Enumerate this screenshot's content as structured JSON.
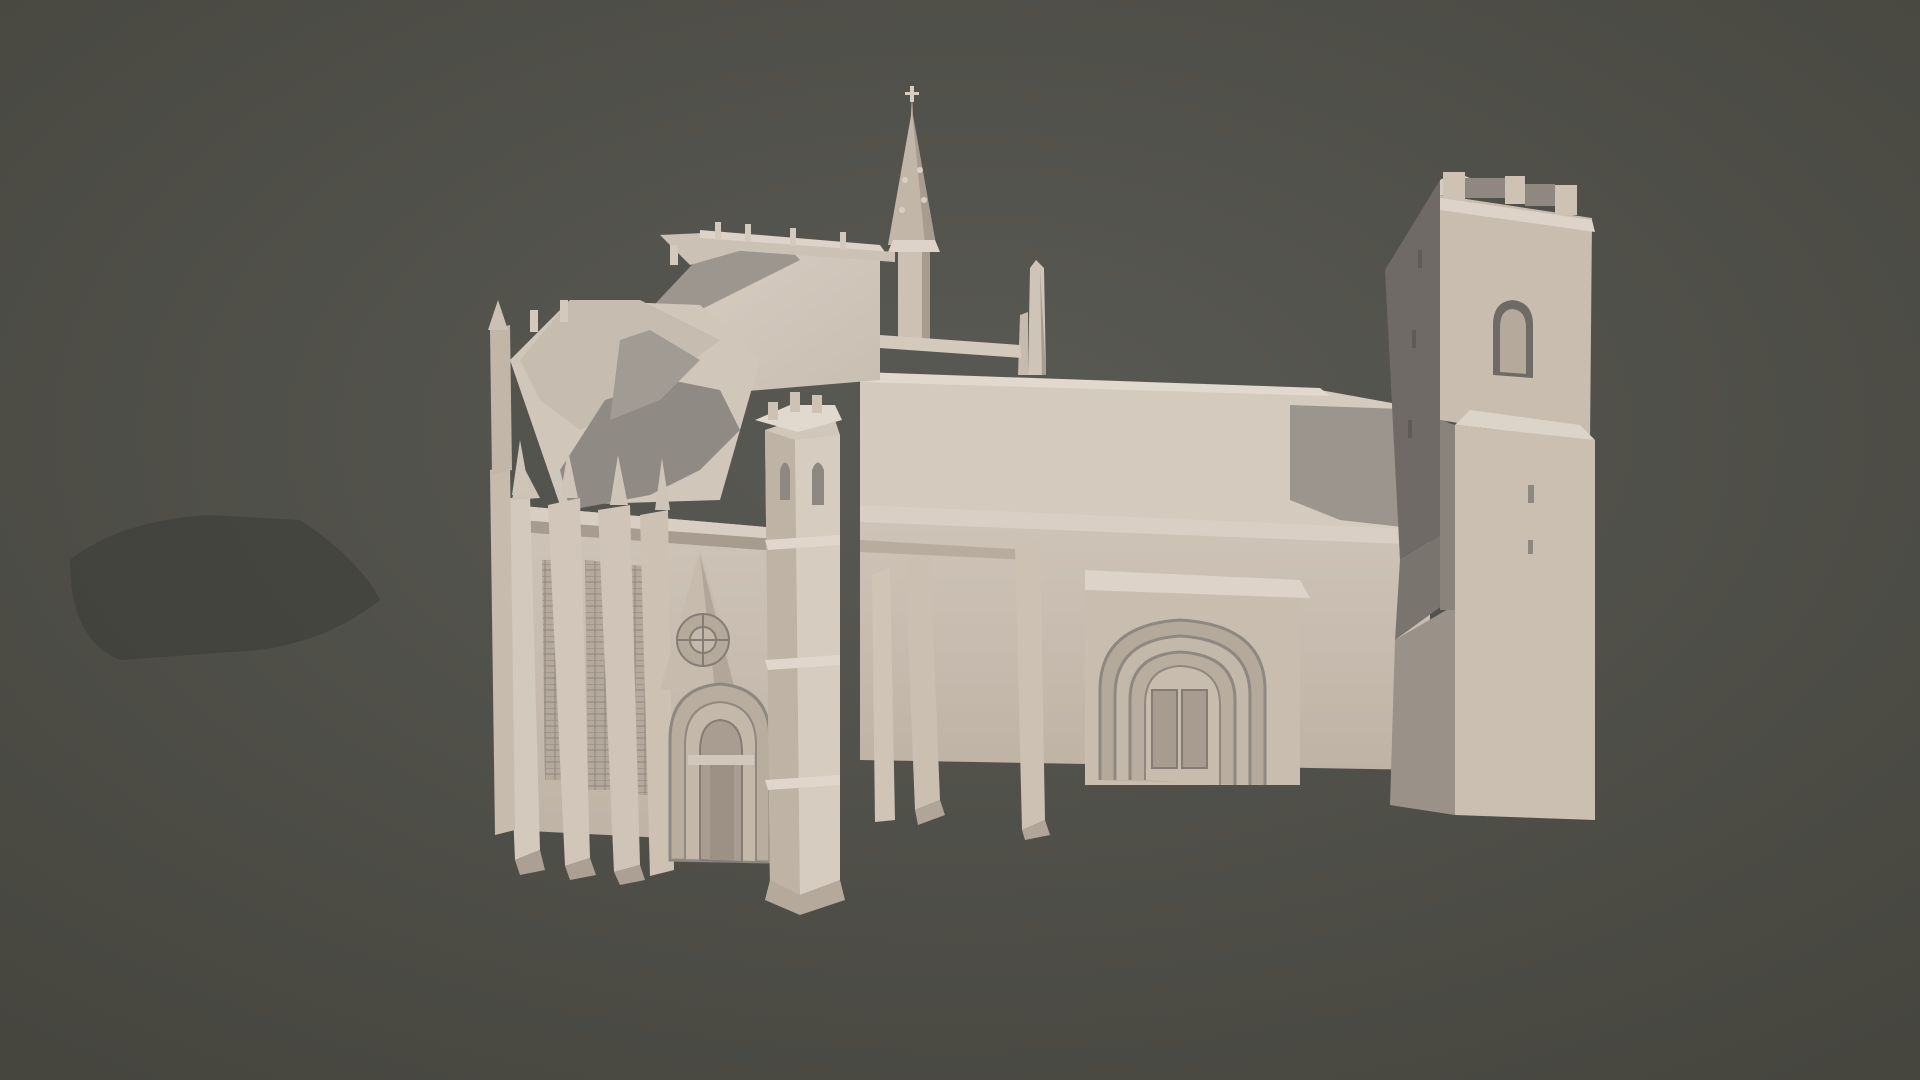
{
  "viewport": {
    "background_top": "#5a5a54",
    "background_bottom": "#46463f",
    "model_light": "#d9cfc4",
    "model_mid": "#c4b8ab",
    "model_shadow": "#8f8880",
    "model_dark": "#6f6a65"
  }
}
